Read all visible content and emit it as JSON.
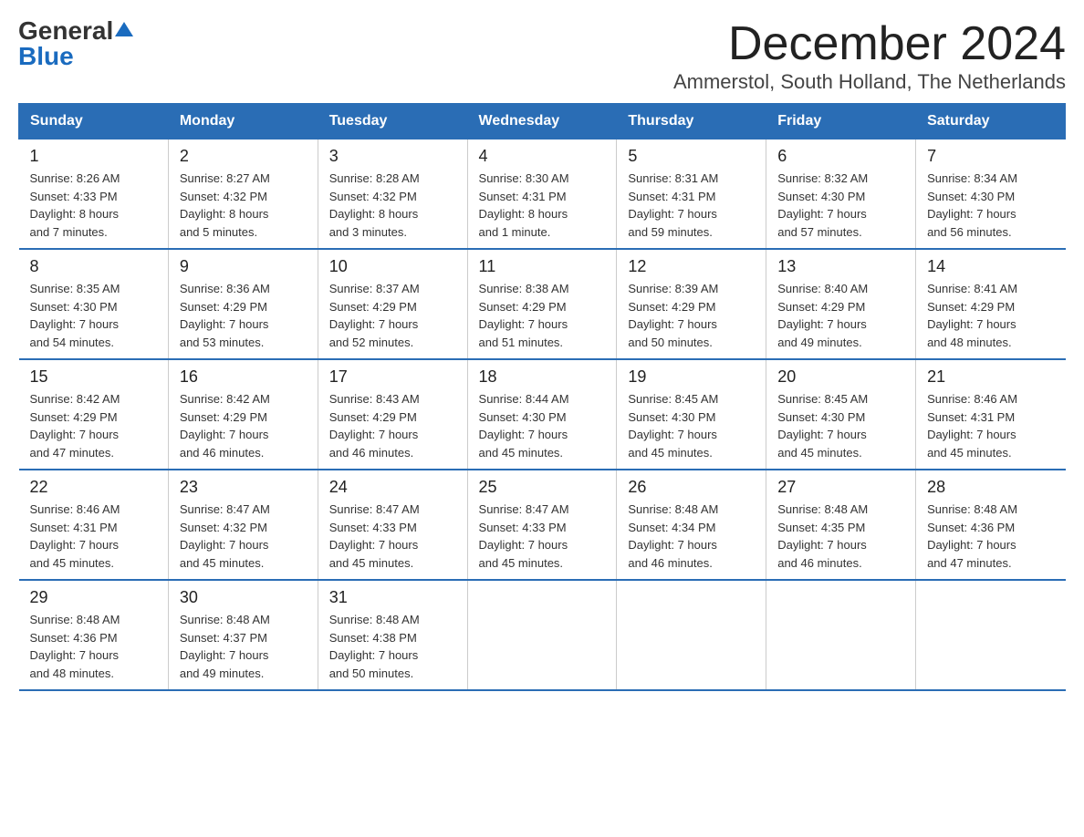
{
  "logo": {
    "general": "General",
    "blue": "Blue"
  },
  "title": "December 2024",
  "location": "Ammerstol, South Holland, The Netherlands",
  "days_of_week": [
    "Sunday",
    "Monday",
    "Tuesday",
    "Wednesday",
    "Thursday",
    "Friday",
    "Saturday"
  ],
  "weeks": [
    [
      {
        "day": "1",
        "info": "Sunrise: 8:26 AM\nSunset: 4:33 PM\nDaylight: 8 hours\nand 7 minutes."
      },
      {
        "day": "2",
        "info": "Sunrise: 8:27 AM\nSunset: 4:32 PM\nDaylight: 8 hours\nand 5 minutes."
      },
      {
        "day": "3",
        "info": "Sunrise: 8:28 AM\nSunset: 4:32 PM\nDaylight: 8 hours\nand 3 minutes."
      },
      {
        "day": "4",
        "info": "Sunrise: 8:30 AM\nSunset: 4:31 PM\nDaylight: 8 hours\nand 1 minute."
      },
      {
        "day": "5",
        "info": "Sunrise: 8:31 AM\nSunset: 4:31 PM\nDaylight: 7 hours\nand 59 minutes."
      },
      {
        "day": "6",
        "info": "Sunrise: 8:32 AM\nSunset: 4:30 PM\nDaylight: 7 hours\nand 57 minutes."
      },
      {
        "day": "7",
        "info": "Sunrise: 8:34 AM\nSunset: 4:30 PM\nDaylight: 7 hours\nand 56 minutes."
      }
    ],
    [
      {
        "day": "8",
        "info": "Sunrise: 8:35 AM\nSunset: 4:30 PM\nDaylight: 7 hours\nand 54 minutes."
      },
      {
        "day": "9",
        "info": "Sunrise: 8:36 AM\nSunset: 4:29 PM\nDaylight: 7 hours\nand 53 minutes."
      },
      {
        "day": "10",
        "info": "Sunrise: 8:37 AM\nSunset: 4:29 PM\nDaylight: 7 hours\nand 52 minutes."
      },
      {
        "day": "11",
        "info": "Sunrise: 8:38 AM\nSunset: 4:29 PM\nDaylight: 7 hours\nand 51 minutes."
      },
      {
        "day": "12",
        "info": "Sunrise: 8:39 AM\nSunset: 4:29 PM\nDaylight: 7 hours\nand 50 minutes."
      },
      {
        "day": "13",
        "info": "Sunrise: 8:40 AM\nSunset: 4:29 PM\nDaylight: 7 hours\nand 49 minutes."
      },
      {
        "day": "14",
        "info": "Sunrise: 8:41 AM\nSunset: 4:29 PM\nDaylight: 7 hours\nand 48 minutes."
      }
    ],
    [
      {
        "day": "15",
        "info": "Sunrise: 8:42 AM\nSunset: 4:29 PM\nDaylight: 7 hours\nand 47 minutes."
      },
      {
        "day": "16",
        "info": "Sunrise: 8:42 AM\nSunset: 4:29 PM\nDaylight: 7 hours\nand 46 minutes."
      },
      {
        "day": "17",
        "info": "Sunrise: 8:43 AM\nSunset: 4:29 PM\nDaylight: 7 hours\nand 46 minutes."
      },
      {
        "day": "18",
        "info": "Sunrise: 8:44 AM\nSunset: 4:30 PM\nDaylight: 7 hours\nand 45 minutes."
      },
      {
        "day": "19",
        "info": "Sunrise: 8:45 AM\nSunset: 4:30 PM\nDaylight: 7 hours\nand 45 minutes."
      },
      {
        "day": "20",
        "info": "Sunrise: 8:45 AM\nSunset: 4:30 PM\nDaylight: 7 hours\nand 45 minutes."
      },
      {
        "day": "21",
        "info": "Sunrise: 8:46 AM\nSunset: 4:31 PM\nDaylight: 7 hours\nand 45 minutes."
      }
    ],
    [
      {
        "day": "22",
        "info": "Sunrise: 8:46 AM\nSunset: 4:31 PM\nDaylight: 7 hours\nand 45 minutes."
      },
      {
        "day": "23",
        "info": "Sunrise: 8:47 AM\nSunset: 4:32 PM\nDaylight: 7 hours\nand 45 minutes."
      },
      {
        "day": "24",
        "info": "Sunrise: 8:47 AM\nSunset: 4:33 PM\nDaylight: 7 hours\nand 45 minutes."
      },
      {
        "day": "25",
        "info": "Sunrise: 8:47 AM\nSunset: 4:33 PM\nDaylight: 7 hours\nand 45 minutes."
      },
      {
        "day": "26",
        "info": "Sunrise: 8:48 AM\nSunset: 4:34 PM\nDaylight: 7 hours\nand 46 minutes."
      },
      {
        "day": "27",
        "info": "Sunrise: 8:48 AM\nSunset: 4:35 PM\nDaylight: 7 hours\nand 46 minutes."
      },
      {
        "day": "28",
        "info": "Sunrise: 8:48 AM\nSunset: 4:36 PM\nDaylight: 7 hours\nand 47 minutes."
      }
    ],
    [
      {
        "day": "29",
        "info": "Sunrise: 8:48 AM\nSunset: 4:36 PM\nDaylight: 7 hours\nand 48 minutes."
      },
      {
        "day": "30",
        "info": "Sunrise: 8:48 AM\nSunset: 4:37 PM\nDaylight: 7 hours\nand 49 minutes."
      },
      {
        "day": "31",
        "info": "Sunrise: 8:48 AM\nSunset: 4:38 PM\nDaylight: 7 hours\nand 50 minutes."
      },
      null,
      null,
      null,
      null
    ]
  ]
}
